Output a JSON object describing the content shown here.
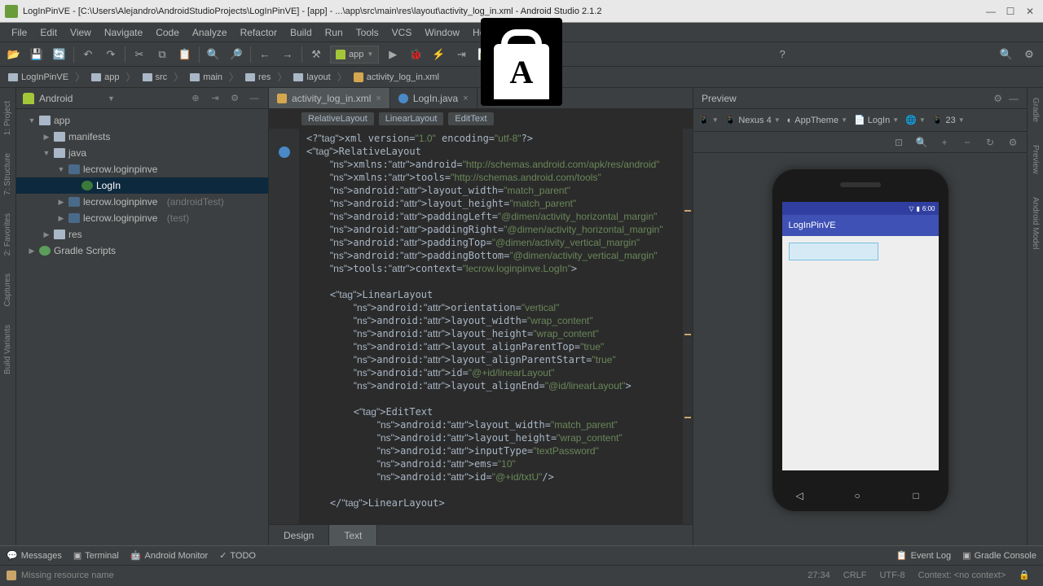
{
  "window": {
    "title": "LogInPinVE - [C:\\Users\\Alejandro\\AndroidStudioProjects\\LogInPinVE] - [app] - ...\\app\\src\\main\\res\\layout\\activity_log_in.xml - Android Studio 2.1.2"
  },
  "menu": [
    "File",
    "Edit",
    "View",
    "Navigate",
    "Code",
    "Analyze",
    "Refactor",
    "Build",
    "Run",
    "Tools",
    "VCS",
    "Window",
    "Help"
  ],
  "run_config": "app",
  "breadcrumbs": [
    "LogInPinVE",
    "app",
    "src",
    "main",
    "res",
    "layout",
    "activity_log_in.xml"
  ],
  "project": {
    "view": "Android",
    "tree": {
      "app": "app",
      "manifests": "manifests",
      "java": "java",
      "pkg1": "lecrow.loginpinve",
      "login": "LogIn",
      "pkg2": "lecrow.loginpinve",
      "pkg2suffix": "(androidTest)",
      "pkg3": "lecrow.loginpinve",
      "pkg3suffix": "(test)",
      "res": "res",
      "gradle": "Gradle Scripts"
    }
  },
  "editor": {
    "tabs": [
      {
        "label": "activity_log_in.xml",
        "type": "xml",
        "active": true
      },
      {
        "label": "LogIn.java",
        "type": "java",
        "active": false
      }
    ],
    "path_crumbs": [
      "RelativeLayout",
      "LinearLayout",
      "EditText"
    ],
    "bottom_tabs": {
      "design": "Design",
      "text": "Text"
    }
  },
  "code": {
    "lines": [
      {
        "raw": "<?xml version=\"1.0\" encoding=\"utf-8\"?>"
      },
      {
        "raw": "<RelativeLayout"
      },
      {
        "raw": "    xmlns:android=\"http://schemas.android.com/apk/res/android\""
      },
      {
        "raw": "    xmlns:tools=\"http://schemas.android.com/tools\""
      },
      {
        "raw": "    android:layout_width=\"match_parent\""
      },
      {
        "raw": "    android:layout_height=\"match_parent\""
      },
      {
        "raw": "    android:paddingLeft=\"@dimen/activity_horizontal_margin\""
      },
      {
        "raw": "    android:paddingRight=\"@dimen/activity_horizontal_margin\""
      },
      {
        "raw": "    android:paddingTop=\"@dimen/activity_vertical_margin\""
      },
      {
        "raw": "    android:paddingBottom=\"@dimen/activity_vertical_margin\""
      },
      {
        "raw": "    tools:context=\"lecrow.loginpinve.LogIn\">"
      },
      {
        "raw": ""
      },
      {
        "raw": "    <LinearLayout"
      },
      {
        "raw": "        android:orientation=\"vertical\""
      },
      {
        "raw": "        android:layout_width=\"wrap_content\""
      },
      {
        "raw": "        android:layout_height=\"wrap_content\""
      },
      {
        "raw": "        android:layout_alignParentTop=\"true\""
      },
      {
        "raw": "        android:layout_alignParentStart=\"true\""
      },
      {
        "raw": "        android:id=\"@+id/linearLayout\""
      },
      {
        "raw": "        android:layout_alignEnd=\"@id/linearLayout\">"
      },
      {
        "raw": ""
      },
      {
        "raw": "        <EditText"
      },
      {
        "raw": "            android:layout_width=\"match_parent\""
      },
      {
        "raw": "            android:layout_height=\"wrap_content\""
      },
      {
        "raw": "            android:inputType=\"textPassword\""
      },
      {
        "raw": "            android:ems=\"10\""
      },
      {
        "raw": "            android:id=\"@+id/txtU\"/>"
      },
      {
        "raw": ""
      },
      {
        "raw": "    </LinearLayout>"
      }
    ]
  },
  "preview": {
    "title": "Preview",
    "device": "Nexus 4",
    "theme": "AppTheme",
    "activity": "LogIn",
    "api": "23",
    "app_title": "LogInPinVE",
    "clock": "6:00"
  },
  "statusbar": {
    "messages": "Messages",
    "terminal": "Terminal",
    "android_monitor": "Android Monitor",
    "todo": "TODO",
    "event_log": "Event Log",
    "gradle_console": "Gradle Console"
  },
  "footer": {
    "msg": "Missing resource name",
    "pos": "27:34",
    "lineend": "CRLF",
    "encoding": "UTF-8",
    "context": "Context: <no context>"
  },
  "side_tools": {
    "left": [
      "1: Project",
      "7: Structure",
      "2: Favorites",
      "Captures",
      "Build Variants"
    ],
    "right": [
      "Gradle",
      "Preview",
      "Android Model"
    ]
  }
}
